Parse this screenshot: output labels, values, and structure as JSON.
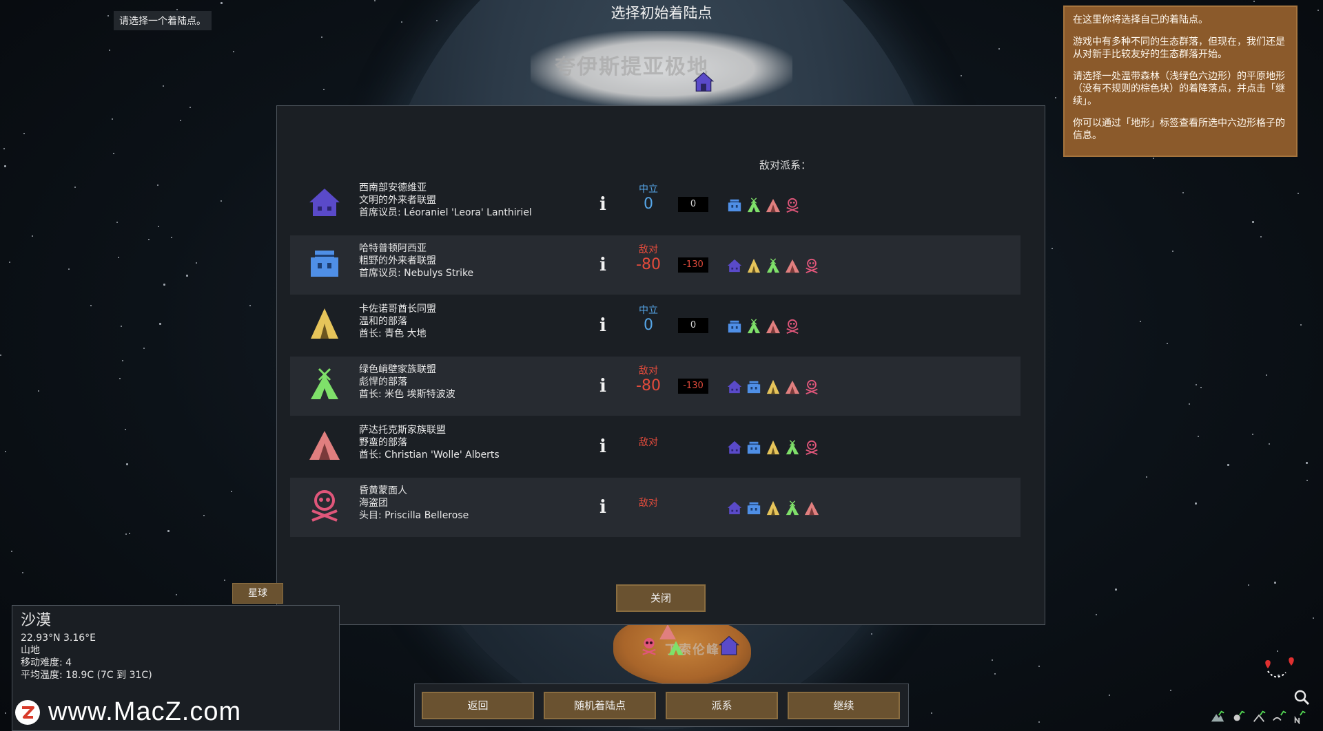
{
  "screen": {
    "title": "选择初始着陆点",
    "hint": "请选择一个着陆点。"
  },
  "map": {
    "north_label": "夸伊斯提亚极地",
    "south_label": "丁索伦峰"
  },
  "tutorial": {
    "p1": "在这里你将选择自己的着陆点。",
    "p2": "游戏中有多种不同的生态群落，但现在，我们还是从对新手比较友好的生态群落开始。",
    "p3": "请选择一处温带森林（浅绿色六边形）的平原地形（没有不规则的棕色块）的着降落点，并点击「继续」。",
    "p4": "你可以通过「地形」标签查看所选中六边形格子的信息。"
  },
  "dialog": {
    "hostile_header": "敌对派系：",
    "close_label": "关闭",
    "factions": [
      {
        "name": "西南部安德维亚",
        "type": "文明的外来者联盟",
        "leader": "首席议员: Léoraniel 'Leora' Lanthiriel",
        "icon": "house-purple-icon",
        "relation": "中立",
        "relation_kind": "neutral",
        "goodwill": "0",
        "natural_goodwill": "0",
        "enemies": [
          "house-blue-icon",
          "tipi-green-icon",
          "tent-red-icon",
          "skull-pink-icon"
        ]
      },
      {
        "name": "哈特普顿阿西亚",
        "type": "粗野的外来者联盟",
        "leader": "首席议员: Nebulys Strike",
        "icon": "house-blue-icon",
        "relation": "敌对",
        "relation_kind": "hostile",
        "goodwill": "-80",
        "natural_goodwill": "-130",
        "enemies": [
          "house-purple-icon",
          "tent-yellow-icon",
          "tipi-green-icon",
          "tent-red-icon",
          "skull-pink-icon"
        ]
      },
      {
        "name": "卡佐诺哥酋长同盟",
        "type": "温和的部落",
        "leader": "酋长: 青色 大地",
        "icon": "tent-yellow-icon",
        "relation": "中立",
        "relation_kind": "neutral",
        "goodwill": "0",
        "natural_goodwill": "0",
        "enemies": [
          "house-blue-icon",
          "tipi-green-icon",
          "tent-red-icon",
          "skull-pink-icon"
        ]
      },
      {
        "name": "绿色峭壁家族联盟",
        "type": "彪悍的部落",
        "leader": "酋长: 米色 埃斯特波波",
        "icon": "tipi-green-icon",
        "relation": "敌对",
        "relation_kind": "hostile",
        "goodwill": "-80",
        "natural_goodwill": "-130",
        "enemies": [
          "house-purple-icon",
          "house-blue-icon",
          "tent-yellow-icon",
          "tent-red-icon",
          "skull-pink-icon"
        ]
      },
      {
        "name": "萨达托克斯家族联盟",
        "type": "野蛮的部落",
        "leader": "酋长: Christian 'Wolle' Alberts",
        "icon": "tent-red-icon",
        "relation": "敌对",
        "relation_kind": "hostile",
        "goodwill": "",
        "natural_goodwill": "",
        "enemies": [
          "house-purple-icon",
          "house-blue-icon",
          "tent-yellow-icon",
          "tipi-green-icon",
          "skull-pink-icon"
        ]
      },
      {
        "name": "昏黄蒙面人",
        "type": "海盗团",
        "leader": "头目: Priscilla Bellerose",
        "icon": "skull-pink-icon",
        "relation": "敌对",
        "relation_kind": "hostile",
        "goodwill": "",
        "natural_goodwill": "",
        "enemies": [
          "house-purple-icon",
          "house-blue-icon",
          "tent-yellow-icon",
          "tipi-green-icon",
          "tent-red-icon"
        ]
      }
    ]
  },
  "tile": {
    "tab_label": "星球",
    "biome": "沙漠",
    "coords": "22.93°N 3.16°E",
    "terrain": "山地",
    "movement": "移动难度: 4",
    "temperature": "平均温度: 18.9C (7C 到 31C)"
  },
  "watermark": "www.MacZ.com",
  "bottom_buttons": {
    "back": "返回",
    "random": "随机着陆点",
    "factions": "派系",
    "next": "继续"
  },
  "colors": {
    "house-purple": "#5a4ac9",
    "house-blue": "#4f8fe6",
    "tent-yellow": "#e6c45a",
    "tipi-green": "#7fe06a",
    "tent-red": "#e07f7f",
    "skull-pink": "#e0567a",
    "neutral": "#56a6e8",
    "hostile": "#e24b3c",
    "button": "#6a5230",
    "tutorial_bg": "#8b5a2b"
  }
}
